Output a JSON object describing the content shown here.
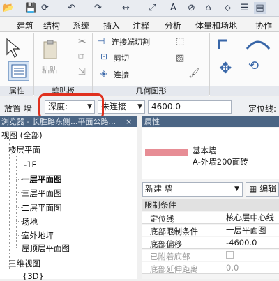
{
  "menu": [
    "建筑",
    "结构",
    "系统",
    "插入",
    "注释",
    "分析",
    "体量和场地",
    "协作"
  ],
  "ribbon": {
    "paste": "粘贴",
    "join_end_cut": "连接端切割",
    "cut": "剪切",
    "connect": "连接",
    "panels": {
      "properties": "属性",
      "clipboard": "剪贴板",
      "geometry": "几何图形"
    }
  },
  "options": {
    "place_wall": "放置 墙",
    "depth": "深度:",
    "unconnected": "未连接",
    "offset_value": "4600.0",
    "location_line": "定位线:"
  },
  "browser": {
    "title": "浏览器 - 长胜路东侧...平面公路...",
    "items": [
      {
        "label": "视图 (全部)",
        "depth": 0,
        "toggle": "-"
      },
      {
        "label": "楼层平面",
        "depth": 1,
        "toggle": "-"
      },
      {
        "label": "-1F",
        "depth": 2
      },
      {
        "label": "一层平面图",
        "depth": 2,
        "bold": true
      },
      {
        "label": "三层平面图",
        "depth": 2
      },
      {
        "label": "二层平面图",
        "depth": 2
      },
      {
        "label": "场地",
        "depth": 2
      },
      {
        "label": "室外地坪",
        "depth": 2
      },
      {
        "label": "屋顶层平面图",
        "depth": 2
      },
      {
        "label": "三维视图",
        "depth": 1,
        "toggle": "-"
      },
      {
        "label": "{3D}",
        "depth": 2
      }
    ]
  },
  "properties": {
    "title": "属性",
    "type_family": "基本墙",
    "type_name": "A-外墙200面砖",
    "new_selector": "新建 墙",
    "edit_type": "编辑",
    "section": "限制条件",
    "rows": [
      {
        "k": "定位线",
        "v": "核心层中心线"
      },
      {
        "k": "底部限制条件",
        "v": "一层平面图"
      },
      {
        "k": "底部偏移",
        "v": "-4600.0"
      },
      {
        "k": "已附着底部",
        "v": "",
        "muted": true
      },
      {
        "k": "底部延伸距离",
        "v": "0.0",
        "muted": true
      }
    ]
  },
  "colors": {
    "swatch": "#e78d95",
    "highlight": "#e0301e",
    "header": "#4b6584"
  }
}
